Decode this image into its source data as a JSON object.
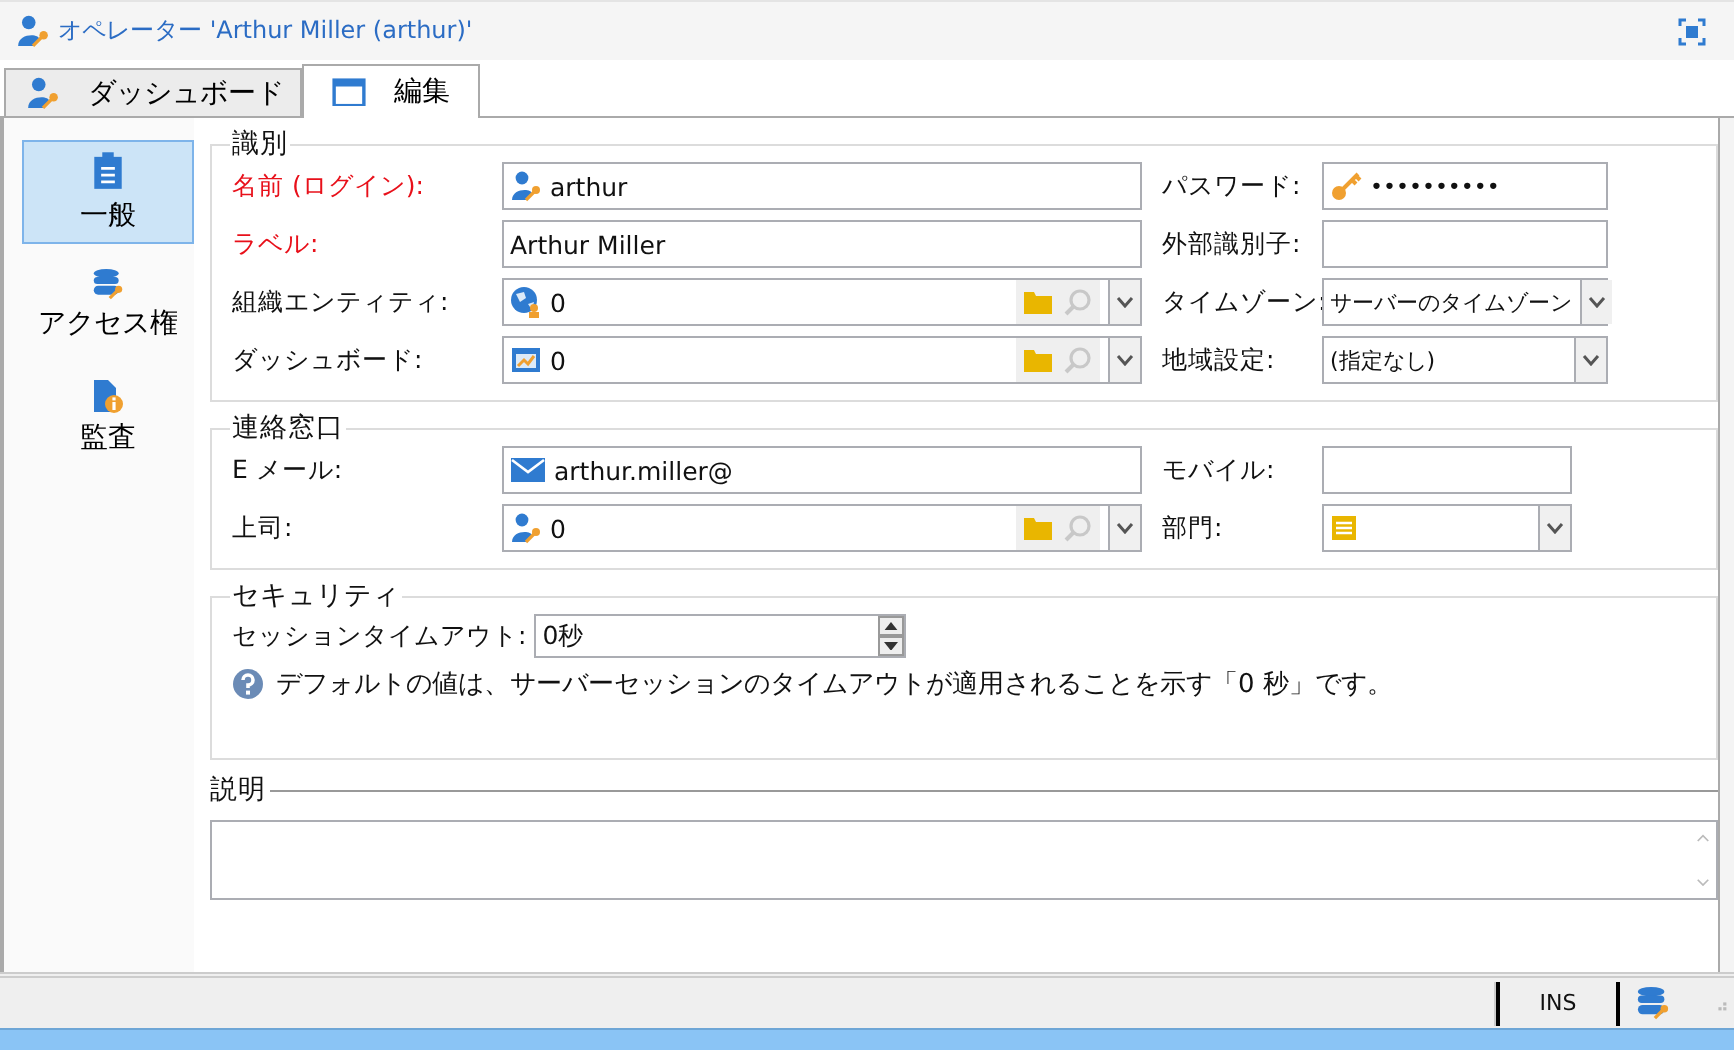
{
  "window": {
    "title": "オペレーター 'Arthur Miller (arthur)'"
  },
  "tabs": [
    {
      "label": "ダッシュボード",
      "selected": false
    },
    {
      "label": "編集",
      "selected": true
    }
  ],
  "sidebar": {
    "items": [
      {
        "label": "一般",
        "selected": true
      },
      {
        "label": "アクセス権",
        "selected": false
      },
      {
        "label": "監査",
        "selected": false
      }
    ]
  },
  "identification": {
    "legend": "識別",
    "rows": [
      {
        "left": {
          "label": "名前 (ログイン):",
          "required": true,
          "kind": "text",
          "value": "arthur"
        },
        "right": {
          "label": "パスワード:",
          "required": false,
          "kind": "text",
          "value": "••••••••••"
        }
      },
      {
        "left": {
          "label": "ラベル:",
          "required": true,
          "kind": "text",
          "value": "Arthur Miller"
        },
        "right": {
          "label": "外部識別子:",
          "required": false,
          "kind": "text"
        }
      },
      {
        "left": {
          "label": "組織エンティティ:",
          "required": false,
          "kind": "lookup",
          "value": "0"
        },
        "right": {
          "label": "タイムゾーン:",
          "required": false,
          "kind": "select",
          "value": "サーバーのタイムゾーン"
        }
      },
      {
        "left": {
          "label": "ダッシュボード:",
          "required": false,
          "kind": "lookup",
          "value": "0"
        },
        "right": {
          "label": "地域設定:",
          "required": false,
          "kind": "select",
          "value": "(指定なし)"
        }
      }
    ]
  },
  "contact": {
    "legend": "連絡窓口",
    "rows": [
      {
        "left": {
          "label": "E メール:",
          "required": false,
          "kind": "text",
          "value": "arthur.miller@"
        },
        "right": {
          "label": "モバイル:",
          "required": false,
          "kind": "text"
        }
      },
      {
        "left": {
          "label": "上司:",
          "required": false,
          "kind": "lookup",
          "value": "0"
        },
        "right": {
          "label": "部門:",
          "required": false,
          "kind": "select"
        }
      }
    ]
  },
  "security": {
    "legend": "セキュリティ",
    "timeout": {
      "label": "セッションタイムアウト:",
      "value": "0秒"
    },
    "help": "デフォルトの値は、サーバーセッションのタイムアウトが適用されることを示す「0 秒」です。"
  },
  "description": {
    "legend": "説明"
  },
  "status_bar": {
    "mode": "INS"
  }
}
